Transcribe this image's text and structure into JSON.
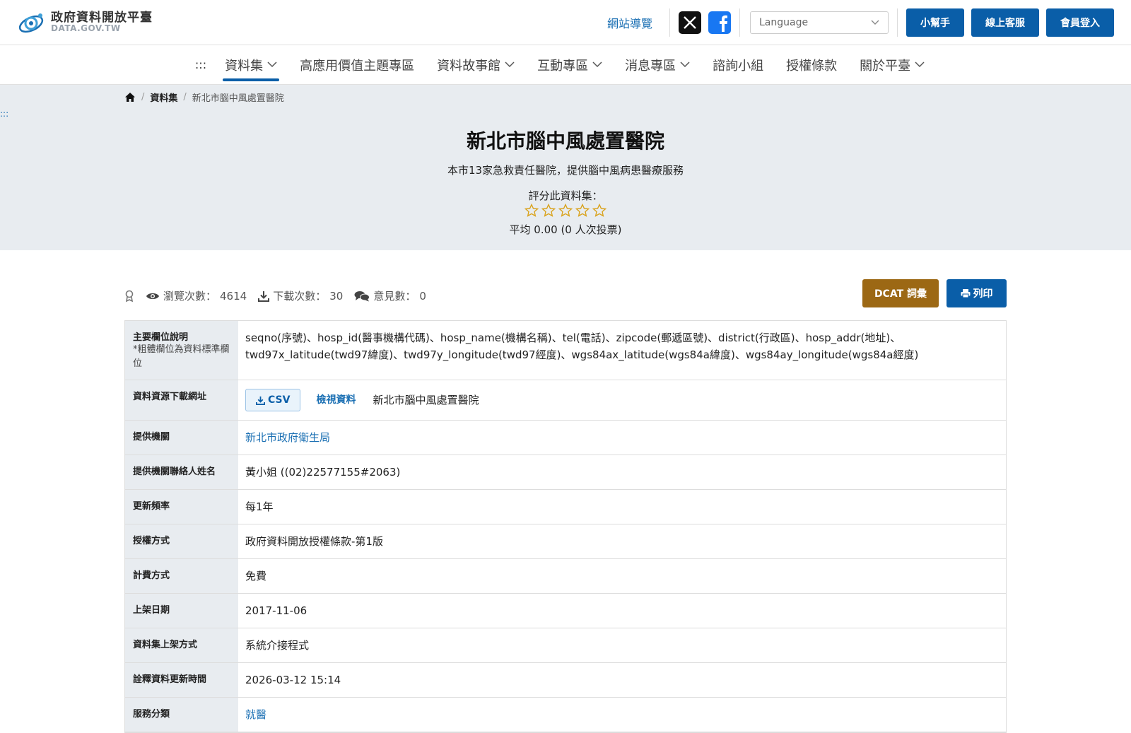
{
  "header": {
    "logo_title": "政府資料開放平臺",
    "logo_sub": "DATA.GOV.TW",
    "sitemap": "網站導覽",
    "language_placeholder": "Language",
    "help_button": "小幫手",
    "service_button": "線上客服",
    "login_button": "會員登入",
    "accent_color": "#0a5ea8"
  },
  "nav": {
    "accesskey": ":::",
    "items": [
      {
        "label": "資料集"
      },
      {
        "label": "高應用價值主題專區"
      },
      {
        "label": "資料故事館"
      },
      {
        "label": "互動專區"
      },
      {
        "label": "消息專區"
      },
      {
        "label": "諮詢小組"
      },
      {
        "label": "授權條款"
      },
      {
        "label": "關於平臺"
      }
    ]
  },
  "breadcrumb": {
    "level1": "資料集",
    "current": "新北市腦中風處置醫院"
  },
  "hero": {
    "accesskey": ":::",
    "title": "新北市腦中風處置醫院",
    "description": "本市13家急救責任醫院，提供腦中風病患醫療服務",
    "rate_label": "評分此資料集：",
    "rating": 0,
    "average": "平均 0.00 (0 人次投票)"
  },
  "stats": {
    "views_label": "瀏覽次數：",
    "views": "4614",
    "downloads_label": "下載次數：",
    "downloads": "30",
    "comments_label": "意見數：",
    "comments": "0",
    "dcat_button": "DCAT 詞彙",
    "print_button": "列印"
  },
  "meta": {
    "fields_label": "主要欄位說明",
    "fields_note": "*粗體欄位為資料標準欄位",
    "fields_value": "seqno(序號)、hosp_id(醫事機構代碼)、hosp_name(機構名稱)、tel(電話)、zipcode(郵遞區號)、district(行政區)、hosp_addr(地址)、twd97x_latitude(twd97緯度)、twd97y_longitude(twd97經度)、wgs84ax_latitude(wgs84a緯度)、wgs84ay_longitude(wgs84a經度)",
    "download_label": "資料資源下載網址",
    "csv": "CSV",
    "preview": "檢視資料",
    "resource_name": "新北市腦中風處置醫院",
    "provider_label": "提供機關",
    "provider": "新北市政府衛生局",
    "contact_label": "提供機關聯絡人姓名",
    "contact": "黃小姐 ((02)22577155#2063)",
    "frequency_label": "更新頻率",
    "frequency": "每1年",
    "license_label": "授權方式",
    "license": "政府資料開放授權條款-第1版",
    "fee_label": "計費方式",
    "fee": "免費",
    "published_label": "上架日期",
    "published": "2017-11-06",
    "method_label": "資料集上架方式",
    "method": "系統介接程式",
    "meta_updated_label": "詮釋資料更新時間",
    "meta_updated": "2026-03-12 15:14",
    "category_label": "服務分類",
    "category": "就醫"
  }
}
